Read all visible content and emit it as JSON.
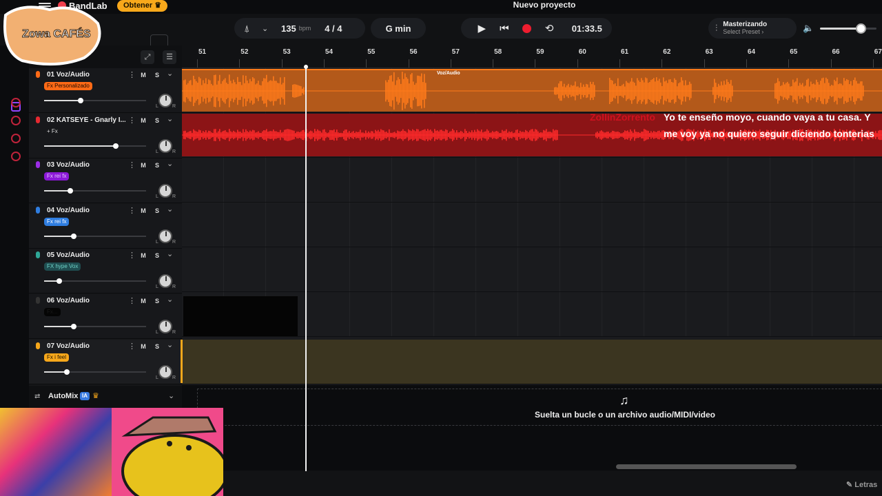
{
  "header": {
    "brand": "BandLab",
    "obtener_label": "Obtener",
    "project_title": "Nuevo proyecto"
  },
  "controls": {
    "bpm_value": "135",
    "bpm_unit": "bpm",
    "time_signature": "4 / 4",
    "key": "G min",
    "time_display": "01:33.5",
    "mastering_title": "Masterizando",
    "mastering_preset": "Select Preset ›",
    "master_volume_percent": 72
  },
  "ruler": {
    "bars": [
      "51",
      "52",
      "53",
      "54",
      "55",
      "56",
      "57",
      "58",
      "59",
      "60",
      "61",
      "62",
      "63",
      "64",
      "65",
      "66",
      "67"
    ]
  },
  "tracks": [
    {
      "name": "01  Voz/Audio",
      "fx": "Fx Personalizado",
      "fx_color": "#ff6a16",
      "fx_text": "#1a0a00",
      "mic_color": "#ff6a16",
      "volume_percent": 36
    },
    {
      "name": "02  KATSEYE - Gnarly I...",
      "fx": "+ Fx",
      "fx_color": "transparent",
      "fx_text": "#dddddd",
      "mic_color": "#e52930",
      "volume_percent": 70
    },
    {
      "name": "03  Voz/Audio",
      "fx": "Fx rei fx",
      "fx_color": "#8c18d8",
      "fx_text": "#e8c8ff",
      "mic_color": "#9b2de6",
      "volume_percent": 26
    },
    {
      "name": "04  Voz/Audio",
      "fx": "Fx rei fx",
      "fx_color": "#2f7de0",
      "fx_text": "#ffffff",
      "mic_color": "#2f7de0",
      "volume_percent": 29
    },
    {
      "name": "05  Voz/Audio",
      "fx": "FX hype Vox",
      "fx_color": "#1f4d50",
      "fx_text": "#6fd3c8",
      "mic_color": "#2ea797",
      "volume_percent": 15
    },
    {
      "name": "06  Voz/Audio",
      "fx": "Fx...",
      "fx_color": "#050505",
      "fx_text": "#1a1a1a",
      "mic_color": "#333333",
      "volume_percent": 29
    },
    {
      "name": "07  Voz/Audio",
      "fx": "Fx i feel",
      "fx_color": "#f8a81b",
      "fx_text": "#1a1200",
      "mic_color": "#f8a81b",
      "volume_percent": 22
    }
  ],
  "track_buttons": {
    "mute": "M",
    "solo": "S",
    "pan_l": "L",
    "pan_r": "R"
  },
  "automix": {
    "label": "AutoMix",
    "badge": "IA"
  },
  "clips": {
    "clip1_label": "Voz/Audio"
  },
  "subtitles": {
    "username": "ZollinZorrento",
    "line1": "Yo te enseño moyo, cuando vaya a tu casa. Y",
    "line2": "me voy ya no quiero seguir diciendo tonterias"
  },
  "dropzone": {
    "text": "Suelta un bucle o un archivo audio/MIDI/video"
  },
  "footer": {
    "letras": "Letras"
  },
  "overlay": {
    "logo_text": "Zowa CAFÉS"
  },
  "colors": {
    "accent": "#f8a81b",
    "record": "#ee1d2f",
    "clip1": "#ff7a1a",
    "clip2": "#d31a1e"
  }
}
